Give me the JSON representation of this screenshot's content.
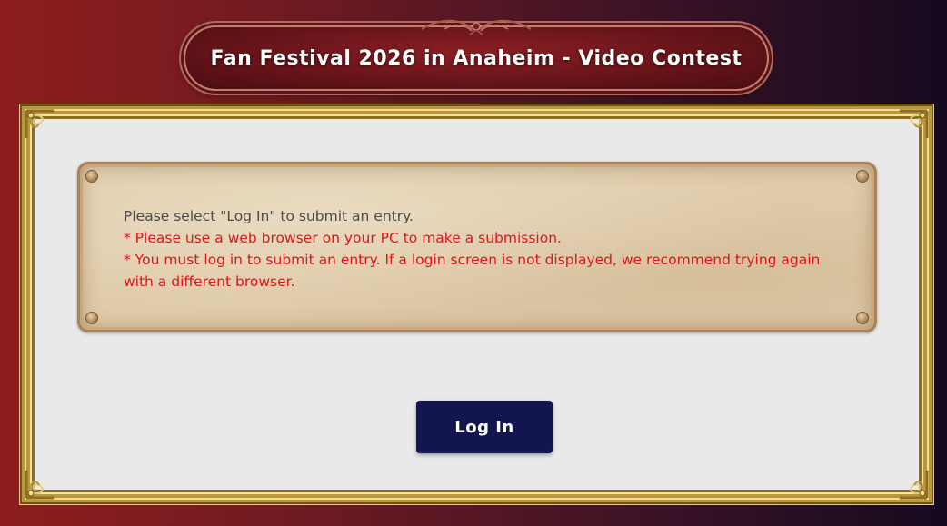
{
  "header": {
    "title": "Fan Festival 2026 in Anaheim - Video Contest"
  },
  "notice": {
    "lines": [
      {
        "text": "Please select \"Log In\" to submit an entry.",
        "style": "plain"
      },
      {
        "text": "* Please use a web browser on your PC to make a submission.",
        "style": "warning"
      },
      {
        "text": "* You must log in to submit an entry. If a login screen is not displayed, we recommend trying again with a different browser.",
        "style": "warning"
      }
    ]
  },
  "actions": {
    "login_label": "Log In"
  },
  "colors": {
    "warning_text": "#e0141a",
    "plain_text": "#4a4a4a",
    "login_button_bg": "#121550",
    "title_banner_bg": "#5e1217",
    "frame_gold": "#b9973e"
  },
  "icons": {
    "title_ornament": "scroll-ornament-icon",
    "frame_corners": "filigree-corner-icon",
    "parchment_rivets": "rivet-icon"
  }
}
